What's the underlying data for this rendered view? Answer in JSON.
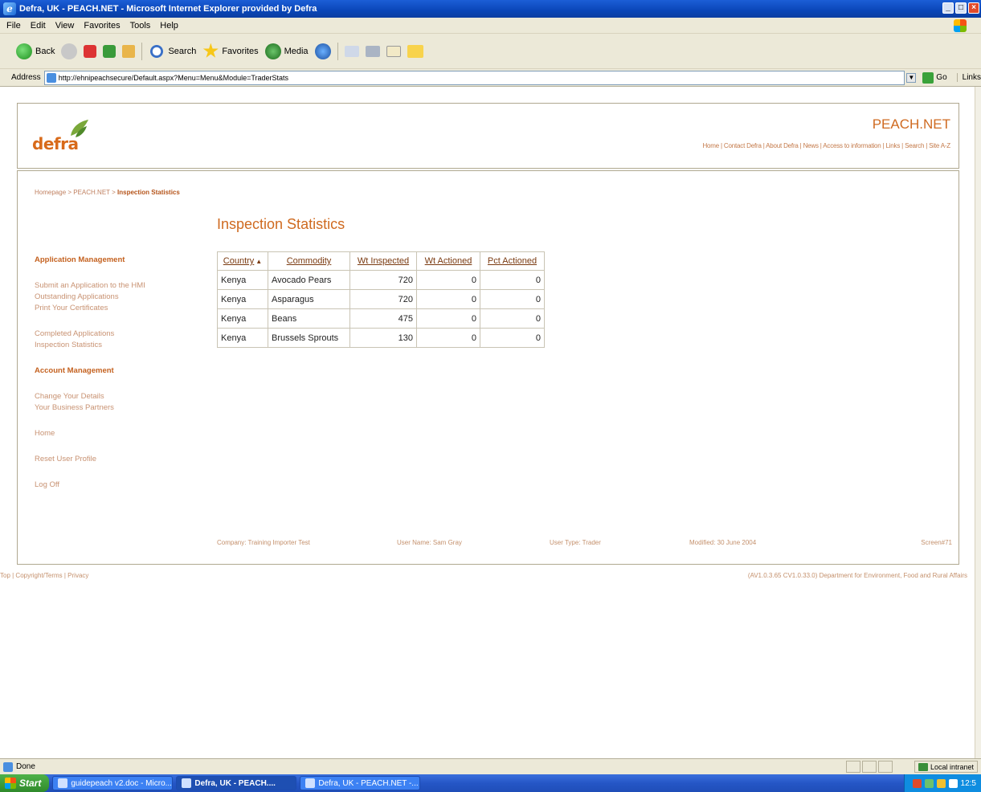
{
  "window": {
    "title": "Defra, UK - PEACH.NET - Microsoft Internet Explorer provided by Defra"
  },
  "menu": [
    "File",
    "Edit",
    "View",
    "Favorites",
    "Tools",
    "Help"
  ],
  "toolbar": {
    "back": "Back",
    "search": "Search",
    "favorites": "Favorites",
    "media": "Media"
  },
  "address": {
    "label": "Address",
    "url": "http://ehnipeachsecure/Default.aspx?Menu=Menu&Module=TraderStats",
    "go": "Go",
    "links": "Links"
  },
  "header": {
    "logo_text": "defra",
    "site_name": "PEACH.NET",
    "top_links": "Home | Contact Defra | About Defra | News | Access to information | Links | Search | Site A-Z"
  },
  "breadcrumb": {
    "trail": "Homepage > PEACH.NET > ",
    "current": "Inspection Statistics"
  },
  "page_title": "Inspection Statistics",
  "sidebar": {
    "app_head": "Application Management",
    "app_items": [
      "Submit an Application to the HMI",
      "Outstanding Applications",
      "Print Your Certificates"
    ],
    "app_items2": [
      "Completed Applications",
      "Inspection Statistics"
    ],
    "acct_head": "Account Management",
    "acct_items": [
      "Change Your Details",
      "Your Business Partners"
    ],
    "home": "Home",
    "reset": "Reset User Profile",
    "logoff": "Log Off"
  },
  "table": {
    "headers": [
      "Country",
      "Commodity",
      "Wt Inspected",
      "Wt Actioned",
      "Pct Actioned"
    ],
    "rows": [
      [
        "Kenya",
        "Avocado Pears",
        "720",
        "0",
        "0"
      ],
      [
        "Kenya",
        "Asparagus",
        "720",
        "0",
        "0"
      ],
      [
        "Kenya",
        "Beans",
        "475",
        "0",
        "0"
      ],
      [
        "Kenya",
        "Brussels Sprouts",
        "130",
        "0",
        "0"
      ]
    ]
  },
  "status_row": {
    "company": "Company: Training Importer Test",
    "user_name": "User Name: Sam Gray",
    "user_type": "User Type: Trader",
    "modified": "Modified: 30 June 2004",
    "screen": "Screen#71"
  },
  "footer": {
    "left": "Top | Copyright/Terms | Privacy",
    "right": "(AV1.0.3.65 CV1.0.33.0) Department for Environment, Food and Rural Affairs"
  },
  "statusbar": {
    "text": "Done",
    "zone": "Local intranet"
  },
  "taskbar": {
    "start": "Start",
    "tasks": [
      "guidepeach v2.doc - Micro...",
      "Defra, UK - PEACH....",
      "Defra, UK - PEACH.NET -..."
    ],
    "clock": "12:5"
  }
}
